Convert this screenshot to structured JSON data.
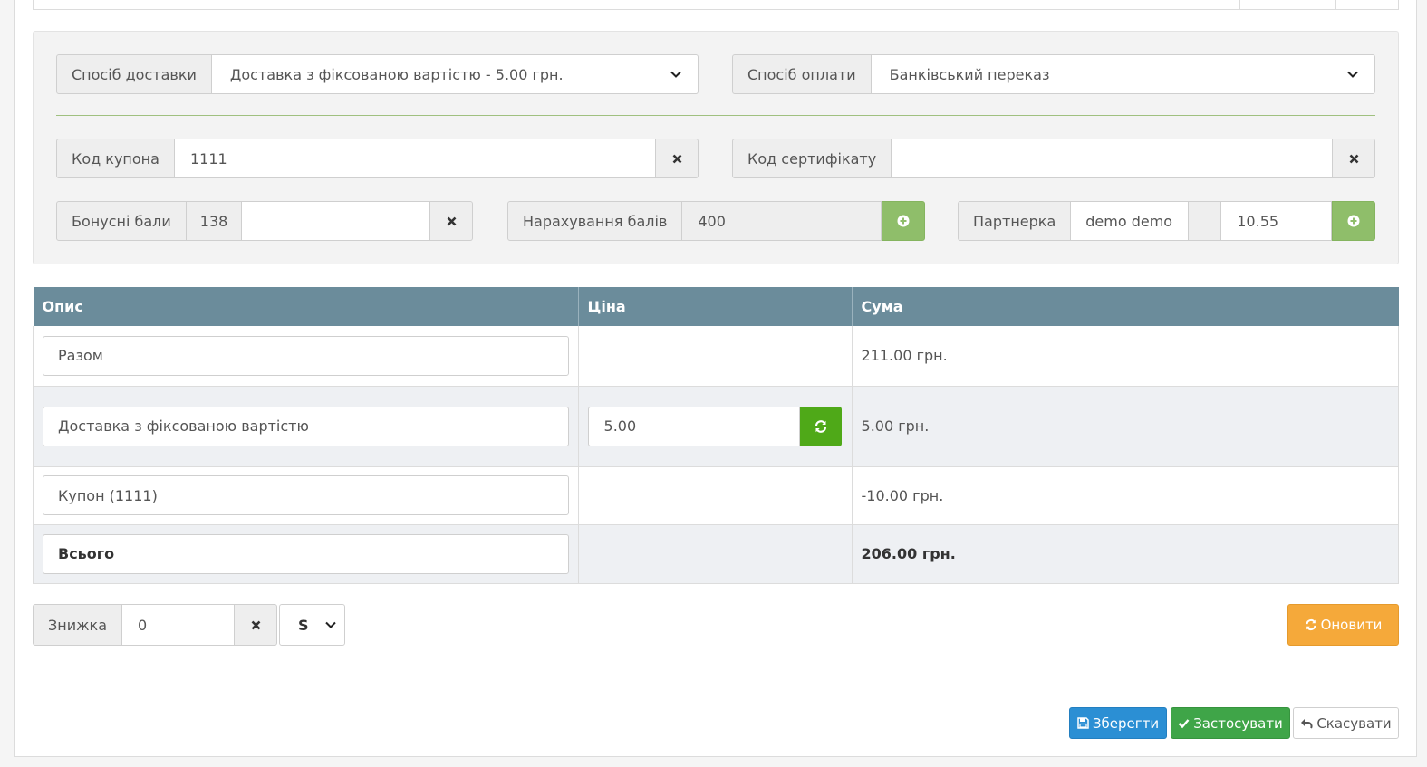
{
  "shipping": {
    "label": "Спосіб доставки",
    "selected": "Доставка з фіксованою вартістю - 5.00 грн."
  },
  "payment": {
    "label": "Спосіб оплати",
    "selected": "Банківський переказ"
  },
  "coupon": {
    "label": "Код купона",
    "value": "1111"
  },
  "certificate": {
    "label": "Код сертифікату",
    "value": ""
  },
  "bonus": {
    "label": "Бонусні бали",
    "balance": "138",
    "value": ""
  },
  "accrual": {
    "label": "Нарахування балів",
    "value": "400"
  },
  "partner": {
    "label": "Партнерка",
    "name": "demo demo",
    "value": "10.55"
  },
  "totals_table": {
    "headers": {
      "description": "Опис",
      "price": "Ціна",
      "sum": "Сума"
    },
    "rows": [
      {
        "description": "Разом",
        "price": "",
        "sum": "211.00 грн."
      },
      {
        "description": "Доставка з фіксованою вартістю",
        "price": "5.00",
        "sum": "5.00 грн."
      },
      {
        "description": "Купон (1111)",
        "price": "",
        "sum": "-10.00 грн."
      },
      {
        "description": "Всього",
        "price": "",
        "sum": "206.00 грн."
      }
    ]
  },
  "discount": {
    "label": "Знижка",
    "value": "0",
    "type": "S"
  },
  "buttons": {
    "refresh": "Оновити",
    "save": "Зберегти",
    "apply": "Застосувати",
    "cancel": "Скасувати"
  },
  "colors": {
    "table_header": "#6b8c9b",
    "green_action": "#4fa918",
    "plus_button": "#8fbe6a",
    "refresh_button": "#f5a93a",
    "save_button": "#2b8fd4",
    "apply_button": "#3fa548"
  },
  "icons": {
    "dropdown": "chevron-down-icon",
    "clear": "close-icon",
    "add": "plus-circle-icon",
    "refresh": "refresh-icon",
    "save": "floppy-icon",
    "apply": "check-icon",
    "cancel": "undo-icon"
  }
}
